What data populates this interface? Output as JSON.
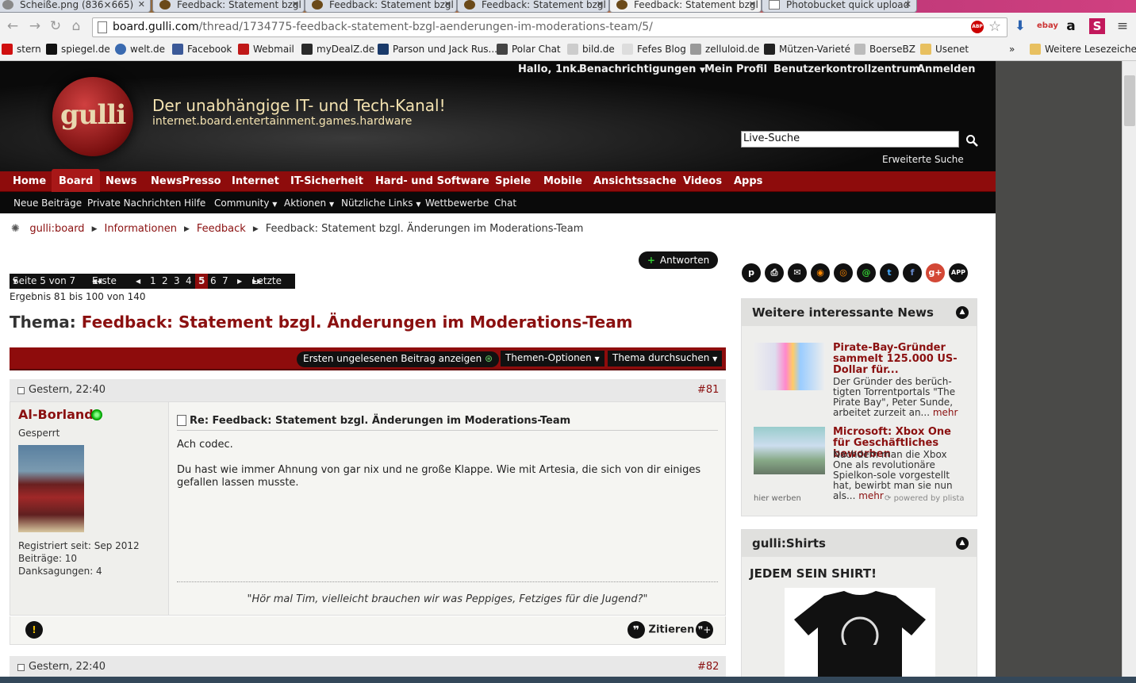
{
  "browser": {
    "tabs": [
      {
        "label": "Scheiße.png (836×665)"
      },
      {
        "label": "Feedback: Statement bzgl"
      },
      {
        "label": "Feedback: Statement bzgl"
      },
      {
        "label": "Feedback: Statement bzgl"
      },
      {
        "label": "Feedback: Statement bzgl"
      },
      {
        "label": "Photobucket quick upload"
      }
    ],
    "url_domain": "board.gulli.com",
    "url_path": "/thread/1734775-feedback-statement-bzgl-aenderungen-im-moderations-team/5/",
    "bookmarks": [
      "stern",
      "spiegel.de",
      "welt.de",
      "Facebook",
      "Webmail",
      "myDealZ.de",
      "Parson und Jack Rus...",
      "Polar Chat",
      "bild.de",
      "Fefes Blog",
      "zelluloid.de",
      "Mützen-Varieté",
      "BoerseBZ",
      "Usenet"
    ],
    "bookmarks_more": "»",
    "other_bookmarks": "Weitere Lesezeichen"
  },
  "header": {
    "logo": "gulli",
    "slogan": "Der unabhängige IT- und Tech-Kanal!",
    "subslogan": "internet.board.entertainment.games.hardware",
    "greeting": "Hallo, 1nk.",
    "notifications": "Benachrichtigungen",
    "profile": "Mein Profil",
    "usercp": "Benutzerkontrollzentrum",
    "login": "Anmelden",
    "search_value": "Live-Suche",
    "advanced_search": "Erweiterte Suche"
  },
  "mainnav": [
    "Home",
    "Board",
    "News",
    "NewsPresso",
    "Internet",
    "IT-Sicherheit",
    "Hard- und Software",
    "Spiele",
    "Mobile",
    "Ansichtssache",
    "Videos",
    "Apps"
  ],
  "subnav": [
    "Neue Beiträge",
    "Private Nachrichten",
    "Hilfe",
    "Community",
    "Aktionen",
    "Nützliche Links",
    "Wettbewerbe",
    "Chat"
  ],
  "breadcrumb": [
    "gulli:board",
    "Informationen",
    "Feedback",
    "Feedback: Statement bzgl. Änderungen im Moderations-Team"
  ],
  "thread": {
    "reply_label": "Antworten",
    "pager": {
      "label": "Seite 5 von 7",
      "first": "Erste",
      "pages": [
        "1",
        "2",
        "3",
        "4",
        "5",
        "6",
        "7"
      ],
      "current": "5",
      "last": "Letzte"
    },
    "result": "Ergebnis 81 bis 100 von 140",
    "title_prefix": "Thema:",
    "title": "Feedback: Statement bzgl. Änderungen im Moderations-Team",
    "first_unread": "Ersten ungelesenen Beitrag anzeigen",
    "options": "Themen-Optionen",
    "search": "Thema durchsuchen"
  },
  "post": {
    "date": "Gestern, 22:40",
    "number": "#81",
    "username": "Al-Borland",
    "usertitle": "Gesperrt",
    "registered": "Registriert seit: Sep 2012",
    "posts": "Beiträge: 10",
    "thanks": "Danksagungen: 4",
    "title": "Re: Feedback: Statement bzgl. Änderungen im Moderations-Team",
    "text1": "Ach codec.",
    "text2": "Du hast wie immer Ahnung von gar nix und ne große Klappe. Wie mit Artesia, die sich von dir einiges gefallen lassen musste.",
    "signature": "\"Hör mal Tim, vielleicht brauchen wir was Peppiges, Fetziges für die Jugend?\"",
    "quote": "Zitieren"
  },
  "post2": {
    "date": "Gestern, 22:40",
    "number": "#82"
  },
  "sidebar": {
    "share_icons": [
      "p",
      "print",
      "mail",
      "rss",
      "rss2",
      "@",
      "twitter",
      "facebook",
      "g+",
      "app"
    ],
    "news_title": "Weitere interessante News",
    "news": [
      {
        "title": "Pirate-Bay-Gründer sammelt 125.000 US-Dollar für...",
        "text": "Der Gründer des berüch-tigten Torrentportals \"The Pirate Bay\", Peter Sunde, arbeitet zurzeit an...",
        "more": "mehr"
      },
      {
        "title": "Microsoft: Xbox One für Geschäftliches beworben",
        "text": "Nachdem man die Xbox One als revolutionäre Spielkon-sole vorgestellt hat, bewirbt man sie nun als...",
        "more": "mehr"
      }
    ],
    "ad_label": "hier werben",
    "powered": "powered by plista",
    "shirts_title": "gulli:Shirts",
    "shirts_slogan": "JEDEM SEIN SHIRT!"
  }
}
